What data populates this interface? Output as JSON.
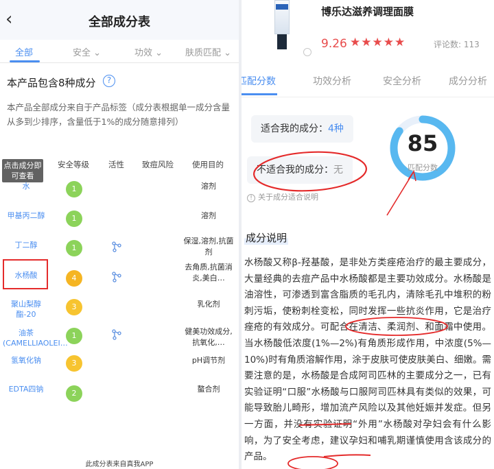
{
  "left_panel": {
    "nav": {
      "back_icon": "chevron-left-icon",
      "title": "全部成分表"
    },
    "tabs": [
      {
        "label": "全部",
        "active": true
      },
      {
        "label": "安全",
        "dropdown": true
      },
      {
        "label": "功效",
        "dropdown": true
      },
      {
        "label": "肤质匹配",
        "dropdown": true
      }
    ],
    "heading": "本产品包含8种成分",
    "description": "本产品全部成分来自于产品标签（成分表根据单一成分含量从多到少排序，含量低于1%的成分随意排列）",
    "tooltip": "点击成分即可查看",
    "columns": [
      "安全等级",
      "活性",
      "致痘风险",
      "使用目的"
    ],
    "rows": [
      {
        "name": "水",
        "safety": "1",
        "active": false,
        "use": "溶剂"
      },
      {
        "name": "甲基丙二醇",
        "safety": "1",
        "active": false,
        "use": "溶剂"
      },
      {
        "name": "丁二醇",
        "safety": "1",
        "active": true,
        "use": "保湿,溶剂,抗菌剂"
      },
      {
        "name": "水杨酸",
        "safety": "4",
        "active": true,
        "use": "去角质,抗菌消炎,美白…"
      },
      {
        "name": "聚山梨醇酯-20",
        "safety": "3",
        "active": false,
        "use": "乳化剂"
      },
      {
        "name": "油茶(CAMELLIAOLEI…",
        "safety": "1",
        "active": true,
        "use": "健美功效成分,抗氧化,…"
      },
      {
        "name": "氢氧化钠",
        "safety": "3",
        "active": false,
        "use": "pH调节剂"
      },
      {
        "name": "EDTA四钠",
        "safety": "2",
        "active": false,
        "use": "螯合剂"
      }
    ],
    "footer": "此成分表来自真我APP",
    "colors": {
      "accent": "#4a8ef0",
      "safe": "#8cd35a",
      "medium": "#f5b523",
      "annotation": "#e42a2a"
    }
  },
  "right_panel": {
    "product": {
      "name": "博乐达滋养调理面膜",
      "rating": "9.26",
      "stars": "★★★★★",
      "reviews": "评论数: 113"
    },
    "tabs": [
      {
        "label": "匹配分数",
        "active": true
      },
      {
        "label": "功效分析"
      },
      {
        "label": "安全分析"
      },
      {
        "label": "成分分析"
      }
    ],
    "suitable": {
      "label": "适合我的成分：",
      "value": "4种"
    },
    "unsuitable": {
      "label": "不适合我的成分：",
      "value": "无"
    },
    "info": "关于成分适合说明",
    "gauge": {
      "score": "85",
      "label": "匹配分数",
      "fraction": 0.85
    },
    "section_title": "成分说明",
    "body": [
      "水杨酸又称β-羟基酸，是非处方类痤疮治疗的最主要成分，大量经典的去痘产品中水杨酸都是主要功效成分。水杨酸是油溶性，可渗透到富含脂质的毛孔内，清除毛孔中堆积的粉刺污垢，使粉刺栓变松，同时发挥一些抗炎作用，它是",
      "治疗痤疮的有效成分",
      "。可配合在清洁、柔润剂、和面霜中使用。当水杨酸低浓度(1%—2%)有角质形成作用，中浓度(5%—10%)时有角质溶解作用，涂于皮肤可使皮肤美白、细嫩。需要注意的是，水杨酸是合成阿司匹林的主要成分之一，已有实验证明“口服”水杨酸与口服阿司匹林具有类似的效果，可能",
      "导致胎儿畸形",
      "，增加流产风险以及其他妊娠并发症。但另一方面，并没有实验证明“外用”水杨酸对",
      "孕妇会有什么影响",
      "，为了安全考虑，建议",
      "孕妇和哺乳期谨慎使用",
      "含该成分的产品。"
    ]
  }
}
